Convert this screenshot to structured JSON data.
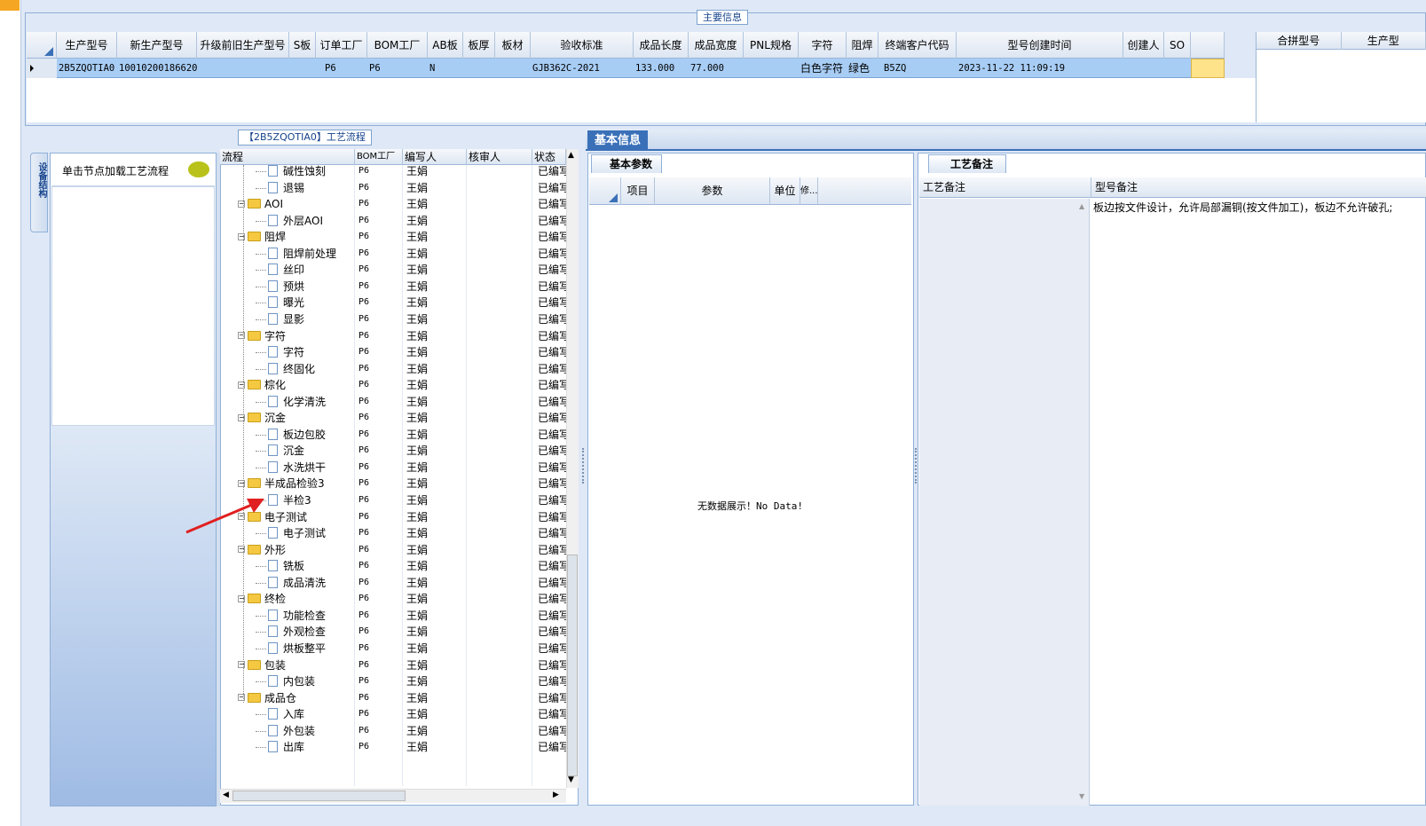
{
  "main_info": {
    "legend": "主要信息",
    "columns": [
      "生产型号",
      "新生产型号",
      "升级前旧生产型号",
      "S板",
      "订单工厂",
      "BOM工厂",
      "AB板",
      "板厚",
      "板材",
      "验收标准",
      "成品长度",
      "成品宽度",
      "PNL规格",
      "字符",
      "阻焊",
      "终端客户代码",
      "型号创建时间",
      "创建人",
      "SO"
    ],
    "row": {
      "prod_model": "2B5ZQOTIA0",
      "new_prod_model": "10010200186620",
      "order_factory": "P6",
      "bom_factory": "P6",
      "ab": "N",
      "standard": "GJB362C-2021",
      "length": "133.000",
      "width": "77.000",
      "char": "白色字符",
      "solder": "绿色",
      "customer_code": "B5ZQ",
      "created": "2023-11-22 11:09:19"
    },
    "merge_columns": [
      "合拼型号",
      "生产型"
    ]
  },
  "flow": {
    "legend": "【2B5ZQOTIA0】工艺流程",
    "vertical_tab": "设备结构",
    "hint": "单击节点加载工艺流程",
    "columns": [
      "流程",
      "BOM工厂",
      "编写人",
      "核审人",
      "状态"
    ],
    "rows": [
      {
        "label": "碱性蚀刻",
        "type": "doc",
        "factory": "P6",
        "writer": "王娟",
        "status": "已编写"
      },
      {
        "label": "退锡",
        "type": "doc",
        "factory": "P6",
        "writer": "王娟",
        "status": "已编写"
      },
      {
        "label": "AOI",
        "type": "folder",
        "factory": "P6",
        "writer": "王娟",
        "status": "已编写"
      },
      {
        "label": "外层AOI",
        "type": "doc",
        "factory": "P6",
        "writer": "王娟",
        "status": "已编写"
      },
      {
        "label": "阻焊",
        "type": "folder",
        "factory": "P6",
        "writer": "王娟",
        "status": "已编写"
      },
      {
        "label": "阻焊前处理",
        "type": "doc",
        "factory": "P6",
        "writer": "王娟",
        "status": "已编写"
      },
      {
        "label": "丝印",
        "type": "doc",
        "factory": "P6",
        "writer": "王娟",
        "status": "已编写"
      },
      {
        "label": "预烘",
        "type": "doc",
        "factory": "P6",
        "writer": "王娟",
        "status": "已编写"
      },
      {
        "label": "曝光",
        "type": "doc",
        "factory": "P6",
        "writer": "王娟",
        "status": "已编写"
      },
      {
        "label": "显影",
        "type": "doc",
        "factory": "P6",
        "writer": "王娟",
        "status": "已编写"
      },
      {
        "label": "字符",
        "type": "folder",
        "factory": "P6",
        "writer": "王娟",
        "status": "已编写"
      },
      {
        "label": "字符",
        "type": "doc",
        "factory": "P6",
        "writer": "王娟",
        "status": "已编写"
      },
      {
        "label": "终固化",
        "type": "doc",
        "factory": "P6",
        "writer": "王娟",
        "status": "已编写"
      },
      {
        "label": "棕化",
        "type": "folder",
        "factory": "P6",
        "writer": "王娟",
        "status": "已编写"
      },
      {
        "label": "化学清洗",
        "type": "doc",
        "factory": "P6",
        "writer": "王娟",
        "status": "已编写"
      },
      {
        "label": "沉金",
        "type": "folder",
        "factory": "P6",
        "writer": "王娟",
        "status": "已编写"
      },
      {
        "label": "板边包胶",
        "type": "doc",
        "factory": "P6",
        "writer": "王娟",
        "status": "已编写"
      },
      {
        "label": "沉金",
        "type": "doc",
        "factory": "P6",
        "writer": "王娟",
        "status": "已编写"
      },
      {
        "label": "水洗烘干",
        "type": "doc",
        "factory": "P6",
        "writer": "王娟",
        "status": "已编写"
      },
      {
        "label": "半成品检验3",
        "type": "folder",
        "factory": "P6",
        "writer": "王娟",
        "status": "已编写"
      },
      {
        "label": "半检3",
        "type": "doc",
        "factory": "P6",
        "writer": "王娟",
        "status": "已编写"
      },
      {
        "label": "电子测试",
        "type": "folder",
        "factory": "P6",
        "writer": "王娟",
        "status": "已编写"
      },
      {
        "label": "电子测试",
        "type": "doc",
        "factory": "P6",
        "writer": "王娟",
        "status": "已编写"
      },
      {
        "label": "外形",
        "type": "folder",
        "factory": "P6",
        "writer": "王娟",
        "status": "已编写"
      },
      {
        "label": "铣板",
        "type": "doc",
        "factory": "P6",
        "writer": "王娟",
        "status": "已编写"
      },
      {
        "label": "成品清洗",
        "type": "doc",
        "factory": "P6",
        "writer": "王娟",
        "status": "已编写"
      },
      {
        "label": "终检",
        "type": "folder",
        "factory": "P6",
        "writer": "王娟",
        "status": "已编写"
      },
      {
        "label": "功能检查",
        "type": "doc",
        "factory": "P6",
        "writer": "王娟",
        "status": "已编写"
      },
      {
        "label": "外观检查",
        "type": "doc",
        "factory": "P6",
        "writer": "王娟",
        "status": "已编写"
      },
      {
        "label": "烘板整平",
        "type": "doc",
        "factory": "P6",
        "writer": "王娟",
        "status": "已编写"
      },
      {
        "label": "包装",
        "type": "folder",
        "factory": "P6",
        "writer": "王娟",
        "status": "已编写"
      },
      {
        "label": "内包装",
        "type": "doc",
        "factory": "P6",
        "writer": "王娟",
        "status": "已编写"
      },
      {
        "label": "成品仓",
        "type": "folder",
        "factory": "P6",
        "writer": "王娟",
        "status": "已编写"
      },
      {
        "label": "入库",
        "type": "doc",
        "factory": "P6",
        "writer": "王娟",
        "status": "已编写"
      },
      {
        "label": "外包装",
        "type": "doc",
        "factory": "P6",
        "writer": "王娟",
        "status": "已编写"
      },
      {
        "label": "出库",
        "type": "doc",
        "factory": "P6",
        "writer": "王娟",
        "status": "已编写"
      }
    ]
  },
  "basic_info": {
    "tab": "基本信息",
    "param_tab": "基本参数",
    "param_columns": [
      "项目",
      "参数",
      "单位",
      "修..."
    ],
    "no_data": "无数据展示！No Data!",
    "note_tab": "工艺备注",
    "note_columns": [
      "工艺备注",
      "型号备注"
    ],
    "model_note": "板边按文件设计，允许局部漏铜(按文件加工)，板边不允许破孔;"
  }
}
